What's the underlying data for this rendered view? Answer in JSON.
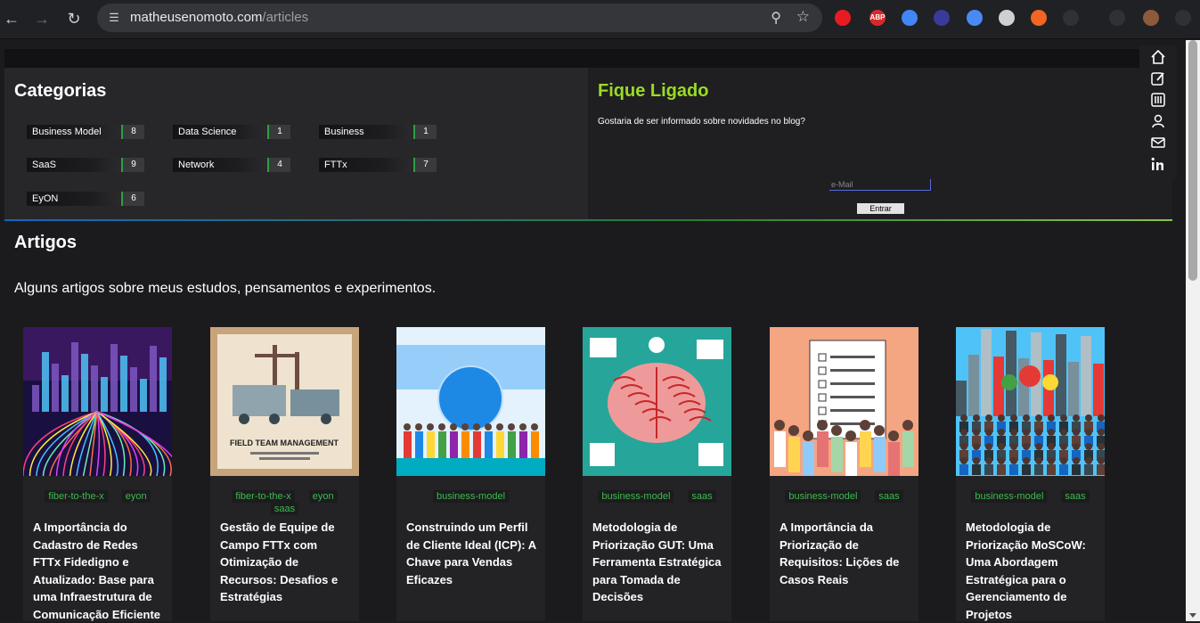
{
  "browser": {
    "url_host": "matheusenomoto.com",
    "url_path": "/articles",
    "extensions": [
      {
        "name": "ublock-icon",
        "color": "#e81b23",
        "label": ""
      },
      {
        "name": "adblock-plus-icon",
        "color": "#d62a2a",
        "label": "ABP"
      },
      {
        "name": "color-picker-icon",
        "color": "#4285f4",
        "label": ""
      },
      {
        "name": "pen-icon",
        "color": "#3a3a9a",
        "label": ""
      },
      {
        "name": "docs-icon",
        "color": "#4a8af4",
        "label": ""
      },
      {
        "name": "window-icon",
        "color": "#d0d0d0",
        "label": ""
      },
      {
        "name": "bolt-icon",
        "color": "#f26522",
        "label": ""
      },
      {
        "name": "puzzle-icon",
        "color": "#303134",
        "label": ""
      },
      {
        "name": "media-icon",
        "color": "#303134",
        "label": ""
      },
      {
        "name": "profile-avatar",
        "color": "#8d5a3b",
        "label": ""
      },
      {
        "name": "kebab-menu-icon",
        "color": "#303134",
        "label": ""
      }
    ]
  },
  "categories": {
    "title": "Categorias",
    "items": [
      {
        "name": "Business Model",
        "count": "8"
      },
      {
        "name": "Data Science",
        "count": "1"
      },
      {
        "name": "Business",
        "count": "1"
      },
      {
        "name": "SaaS",
        "count": "9"
      },
      {
        "name": "Network",
        "count": "4"
      },
      {
        "name": "FTTx",
        "count": "7"
      },
      {
        "name": "EyON",
        "count": "6"
      }
    ]
  },
  "subscribe": {
    "title": "Fique Ligado",
    "question": "Gostaria de ser informado sobre novidades no blog?",
    "email_placeholder": "e-Mail",
    "button": "Entrar"
  },
  "articles": {
    "title": "Artigos",
    "subtitle": "Alguns artigos sobre meus estudos, pensamentos e experimentos.",
    "cards": [
      {
        "tags": [
          "fiber-to-the-x",
          "eyon"
        ],
        "title": "A Importância do Cadastro de Redes FTTx Fidedigno e Atualizado: Base para uma Infraestrutura de Comunicação Eficiente",
        "image": "city-network-illustration",
        "image_text": ""
      },
      {
        "tags": [
          "fiber-to-the-x",
          "eyon",
          "saas"
        ],
        "title": "Gestão de Equipe de Campo FTTx com Otimização de Recursos: Desafios e Estratégias",
        "image": "field-team-management-cover",
        "image_text": "FIELD TEAM MANAGEMENT"
      },
      {
        "tags": [
          "business-model"
        ],
        "title": "Construindo um Perfil de Cliente Ideal (ICP): A Chave para Vendas Eficazes",
        "image": "people-globe-illustration",
        "image_text": ""
      },
      {
        "tags": [
          "business-model",
          "saas"
        ],
        "title": "Metodologia de Priorização GUT: Uma Ferramenta Estratégica para Tomada de Decisões",
        "image": "brain-illustration",
        "image_text": ""
      },
      {
        "tags": [
          "business-model",
          "saas"
        ],
        "title": "A Importância da Priorização de Requisitos: Lições de Casos Reais",
        "image": "requirements-checklist-illustration",
        "image_text": ""
      },
      {
        "tags": [
          "business-model",
          "saas"
        ],
        "title": "Metodologia de Priorização MoSCoW: Uma Abordagem Estratégica para o Gerenciamento de Projetos",
        "image": "moscow-crowd-illustration",
        "image_text": ""
      }
    ]
  }
}
